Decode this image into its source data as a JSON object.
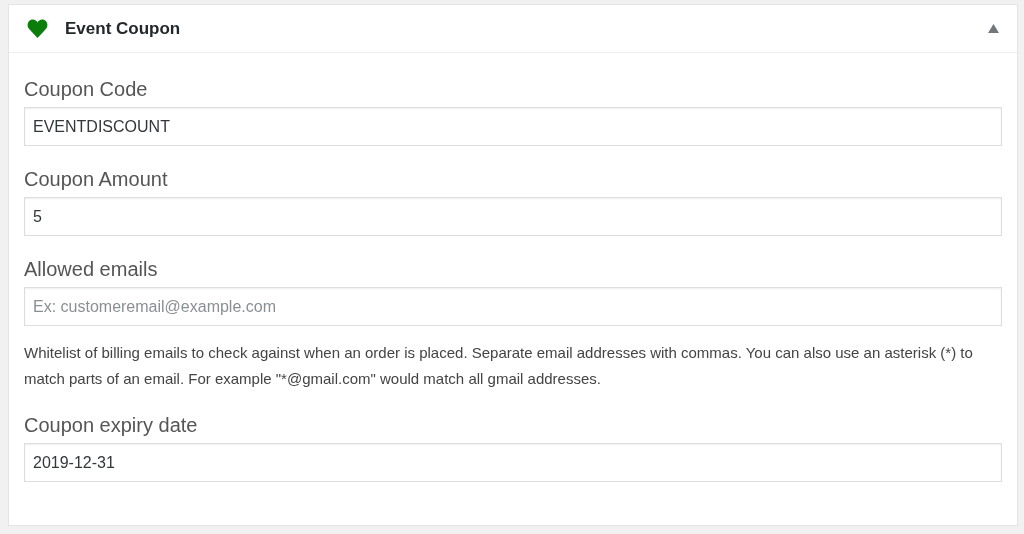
{
  "panel": {
    "title": "Event Coupon",
    "expanded": true
  },
  "fields": [
    {
      "label": "Coupon Code",
      "value": "EVENTDISCOUNT"
    },
    {
      "label": "Coupon Amount",
      "value": "5"
    },
    {
      "label": "Allowed emails",
      "placeholder": "Ex: customeremail@example.com",
      "description": "Whitelist of billing emails to check against when an order is placed. Separate email addresses with commas. You can also use an asterisk (*) to match parts of an email. For example \"*@gmail.com\" would match all gmail addresses."
    },
    {
      "label": "Coupon expiry date",
      "value": "2019-12-31"
    }
  ]
}
